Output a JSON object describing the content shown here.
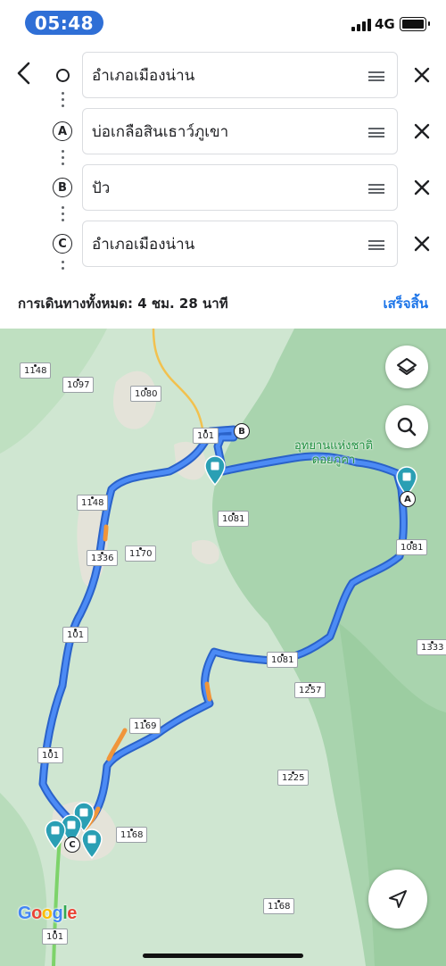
{
  "status_bar": {
    "time": "05:48",
    "network": "4G"
  },
  "directions": {
    "stops": [
      {
        "marker": "",
        "name": "อำเภอเมืองน่าน"
      },
      {
        "marker": "A",
        "name": "บ่อเกลือสินเธาว์ภูเขา"
      },
      {
        "marker": "B",
        "name": "ปัว"
      },
      {
        "marker": "C",
        "name": "อำเภอเมืองน่าน"
      }
    ],
    "total_label": "การเดินทางทั้งหมด: 4 ชม. 28 นาที",
    "done_label": "เสร็จสิ้น"
  },
  "map": {
    "park_label_line1": "อุทยานแห่งชาติ",
    "park_label_line2": "ดอยภูคา",
    "road_shields": [
      "1148",
      "1097",
      "1080",
      "101",
      "1148",
      "1081",
      "1170",
      "1336",
      "1081",
      "101",
      "1333",
      "1081",
      "1257",
      "1169",
      "101",
      "1225",
      "1168",
      "1168",
      "101"
    ],
    "waypoint_markers": [
      "B",
      "A",
      "C"
    ],
    "logo": "Google",
    "colors": {
      "route": "#4c8bf5",
      "route_outline": "#2a62c9",
      "traffic_slow": "#f0953a",
      "park_fill": "#a9d4ae",
      "terrain": "#cfe6d1",
      "highway": "#f2c14e"
    }
  },
  "icons": [
    "back-arrow-icon",
    "drag-handle-icon",
    "close-icon",
    "layers-icon",
    "search-icon",
    "navigation-arrow-icon",
    "map-pin-icon"
  ]
}
